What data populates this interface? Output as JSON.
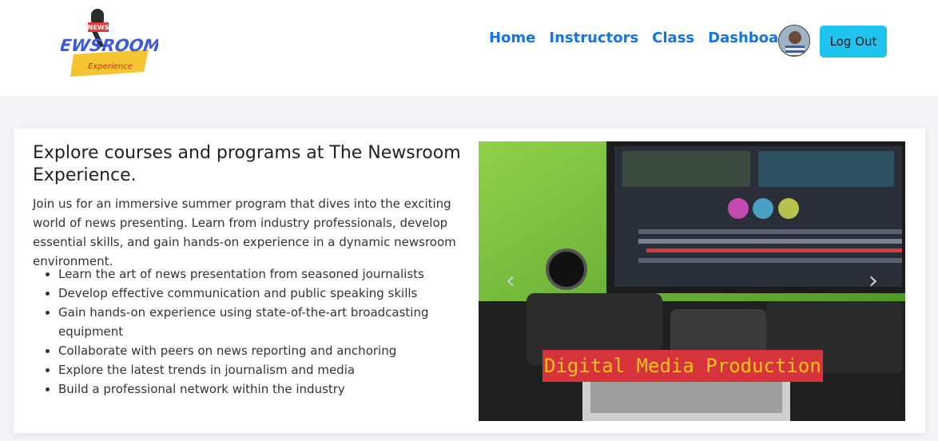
{
  "header": {
    "logo": {
      "top_text": "NEWS",
      "main_text": "NEWSROOM",
      "sub_text": "Experience"
    },
    "nav": [
      "Home",
      "Instructors",
      "Class",
      "Dashboard"
    ],
    "logout_label": "Log Out"
  },
  "hero": {
    "heading": "Explore courses and programs at The Newsroom Experience.",
    "description": "Join us for an immersive summer program that dives into the exciting world of news presenting. Learn from industry professionals, develop essential skills, and gain hands-on experience in a dynamic newsroom environment.",
    "features": [
      "Learn the art of news presentation from seasoned journalists",
      "Develop effective communication and public speaking skills",
      "Gain hands-on experience using state-of-the-art broadcasting equipment",
      "Collaborate with peers on news reporting and anchoring",
      "Explore the latest trends in journalism and media",
      "Build a professional network within the industry"
    ]
  },
  "carousel": {
    "caption": "Digital Media Production",
    "prev_icon": "chevron-left-icon",
    "next_icon": "chevron-right-icon"
  },
  "colors": {
    "nav_link": "#1473e6",
    "logout_bg": "#1ec3ee",
    "caption_bg": "#d7333d",
    "caption_text": "#f5c518"
  }
}
